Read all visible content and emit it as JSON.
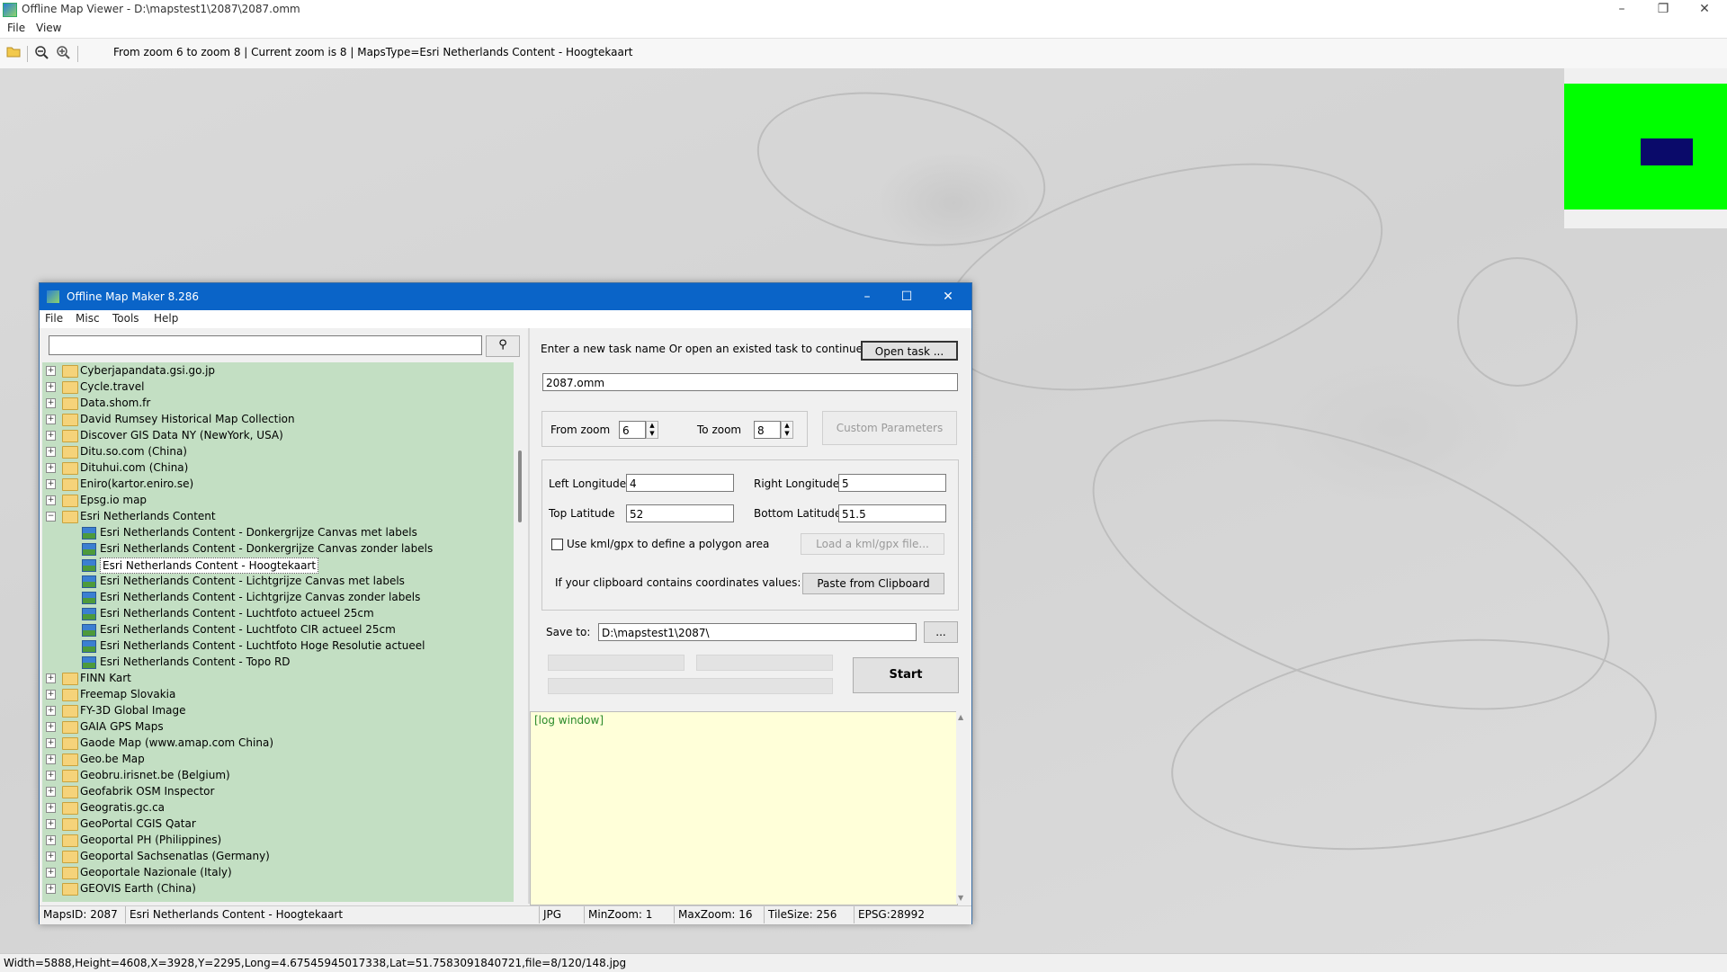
{
  "main_window": {
    "title": "Offline Map Viewer - D:\\mapstest1\\2087\\2087.omm",
    "menu": [
      "File",
      "View"
    ],
    "toolbar_text": "From zoom 6 to zoom 8   |   Current zoom is 8  |   MapsType=Esri Netherlands Content - Hoogtekaart",
    "status": "Width=5888,Height=4608,X=3928,Y=2295,Long=4.67545945017338,Lat=51.7583091840721,file=8/120/148.jpg"
  },
  "dialog": {
    "title": "Offline Map Maker 8.286",
    "menu": [
      "File",
      "Misc",
      "Tools",
      "Help"
    ],
    "search": {
      "value": ""
    },
    "tree": [
      {
        "label": "Cyberjapandata.gsi.go.jp",
        "level": 0,
        "state": "collapsed"
      },
      {
        "label": "Cycle.travel",
        "level": 0,
        "state": "collapsed"
      },
      {
        "label": "Data.shom.fr",
        "level": 0,
        "state": "collapsed"
      },
      {
        "label": "David Rumsey Historical Map Collection",
        "level": 0,
        "state": "collapsed"
      },
      {
        "label": "Discover GIS Data NY (NewYork, USA)",
        "level": 0,
        "state": "collapsed"
      },
      {
        "label": "Ditu.so.com (China)",
        "level": 0,
        "state": "collapsed"
      },
      {
        "label": "Dituhui.com (China)",
        "level": 0,
        "state": "collapsed"
      },
      {
        "label": "Eniro(kartor.eniro.se)",
        "level": 0,
        "state": "collapsed"
      },
      {
        "label": "Epsg.io map",
        "level": 0,
        "state": "collapsed"
      },
      {
        "label": "Esri Netherlands Content",
        "level": 0,
        "state": "expanded"
      },
      {
        "label": "Esri Netherlands Content - Donkergrijze Canvas met labels",
        "level": 1
      },
      {
        "label": "Esri Netherlands Content - Donkergrijze Canvas zonder labels",
        "level": 1
      },
      {
        "label": "Esri Netherlands Content - Hoogtekaart",
        "level": 1,
        "selected": true
      },
      {
        "label": "Esri Netherlands Content - Lichtgrijze Canvas met labels",
        "level": 1
      },
      {
        "label": "Esri Netherlands Content - Lichtgrijze Canvas zonder labels",
        "level": 1
      },
      {
        "label": "Esri Netherlands Content - Luchtfoto actueel 25cm",
        "level": 1
      },
      {
        "label": "Esri Netherlands Content - Luchtfoto CIR actueel 25cm",
        "level": 1
      },
      {
        "label": "Esri Netherlands Content - Luchtfoto Hoge Resolutie actueel",
        "level": 1
      },
      {
        "label": "Esri Netherlands Content - Topo RD",
        "level": 1
      },
      {
        "label": "FINN Kart",
        "level": 0,
        "state": "collapsed"
      },
      {
        "label": "Freemap Slovakia",
        "level": 0,
        "state": "collapsed"
      },
      {
        "label": "FY-3D Global Image",
        "level": 0,
        "state": "collapsed"
      },
      {
        "label": "GAIA GPS Maps",
        "level": 0,
        "state": "collapsed"
      },
      {
        "label": "Gaode Map (www.amap.com China)",
        "level": 0,
        "state": "collapsed"
      },
      {
        "label": "Geo.be Map",
        "level": 0,
        "state": "collapsed"
      },
      {
        "label": "Geobru.irisnet.be (Belgium)",
        "level": 0,
        "state": "collapsed"
      },
      {
        "label": "Geofabrik OSM Inspector",
        "level": 0,
        "state": "collapsed"
      },
      {
        "label": "Geogratis.gc.ca",
        "level": 0,
        "state": "collapsed"
      },
      {
        "label": "GeoPortal CGIS Qatar",
        "level": 0,
        "state": "collapsed"
      },
      {
        "label": "Geoportal PH (Philippines)",
        "level": 0,
        "state": "collapsed"
      },
      {
        "label": "Geoportal Sachsenatlas (Germany)",
        "level": 0,
        "state": "collapsed"
      },
      {
        "label": "Geoportale Nazionale (Italy)",
        "level": 0,
        "state": "collapsed"
      },
      {
        "label": "GEOVIS Earth (China)",
        "level": 0,
        "state": "collapsed"
      }
    ],
    "task_prompt": "Enter a new task name Or open an existed task to continue:",
    "open_task_label": "Open task ...",
    "task_name": "2087.omm",
    "from_zoom_label": "From zoom",
    "from_zoom": "6",
    "to_zoom_label": "To zoom",
    "to_zoom": "8",
    "custom_params_label": "Custom Parameters",
    "left_lon_label": "Left Longitude",
    "left_lon": "4",
    "right_lon_label": "Right Longitude",
    "right_lon": "5",
    "top_lat_label": "Top Latitude",
    "top_lat": "52",
    "bottom_lat_label": "Bottom Latitude",
    "bottom_lat": "51.5",
    "kml_checkbox_label": "Use kml/gpx to define a polygon area",
    "load_kml_label": "Load a kml/gpx file...",
    "clipboard_prompt": "If your clipboard contains coordinates values:",
    "paste_label": "Paste from Clipboard",
    "save_to_label": "Save to:",
    "save_to": "D:\\mapstest1\\2087\\",
    "browse_label": "...",
    "start_label": "Start",
    "log_text": "[log window]",
    "status": {
      "maps_id": "MapsID: 2087",
      "map_name": "Esri Netherlands Content - Hoogtekaart",
      "format": "JPG",
      "min_zoom": "MinZoom: 1",
      "max_zoom": "MaxZoom: 16",
      "tile_size": "TileSize: 256",
      "epsg": "EPSG:28992"
    }
  },
  "colors": {
    "dialog_title": "#0a64c8",
    "tree_bg": "#c3dfc3",
    "log_bg": "#ffffd9",
    "log_text": "#2a8a2a",
    "overview_green": "#00ff00",
    "overview_viewport": "#0a0a6a"
  }
}
